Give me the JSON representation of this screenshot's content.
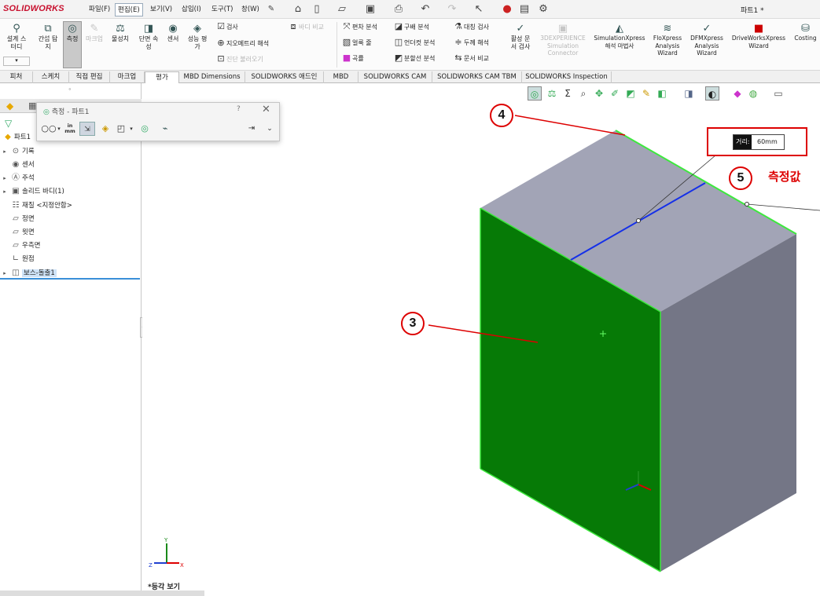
{
  "app": {
    "logo": "SOLIDWORKS",
    "doc_title": "파트1 *"
  },
  "menus": [
    "파일(F)",
    "편집(E)",
    "보기(V)",
    "삽입(I)",
    "도구(T)",
    "창(W)"
  ],
  "ribbon": {
    "big": [
      {
        "label": "설계 스\n터디",
        "icon": "design-study-icon"
      },
      {
        "label": "간섭 탐\n지",
        "icon": "interference-icon"
      },
      {
        "label": "측정",
        "icon": "measure-icon",
        "selected": true
      },
      {
        "label": "마크업",
        "icon": "markup-icon",
        "disabled": true
      },
      {
        "label": "물성치",
        "icon": "mass-properties-icon"
      },
      {
        "label": "단면 속\n성",
        "icon": "section-properties-icon"
      },
      {
        "label": "센서",
        "icon": "sensor-icon"
      },
      {
        "label": "성능 평\n가",
        "icon": "performance-icon"
      }
    ],
    "small_col1": [
      "검사",
      "지오메트리 해석",
      "진단 불러오기"
    ],
    "small_col2": [
      "바디 비교"
    ],
    "small_col3": [
      "편차 분석",
      "얼룩 줄",
      "곡률"
    ],
    "small_col4": [
      "구배 분석",
      "언더컷 분석",
      "분할선 분석"
    ],
    "small_col5": [
      "대칭 검사",
      "두께 해석",
      "문서 비교"
    ],
    "active_check": "활성 문\n서 검사",
    "addins": [
      {
        "label": "3DEXPERIENCE\nSimulation\nConnector",
        "disabled": true
      },
      {
        "label": "SimulationXpress\n해석 마법사"
      },
      {
        "label": "FloXpress\nAnalysis\nWizard"
      },
      {
        "label": "DFMXpress\nAnalysis\nWizard"
      },
      {
        "label": "DriveWorksXpress\nWizard"
      },
      {
        "label": "Costing"
      }
    ]
  },
  "tabs": [
    "피처",
    "스케치",
    "직접 편집",
    "마크업",
    "평가",
    "MBD Dimensions",
    "SOLIDWORKS 애드인",
    "MBD",
    "SOLIDWORKS CAM",
    "SOLIDWORKS CAM TBM",
    "SOLIDWORKS Inspection"
  ],
  "active_tab": "평가",
  "tree": {
    "root": "파트1",
    "items": [
      {
        "label": "기록",
        "expandable": true
      },
      {
        "label": "센서",
        "expandable": false
      },
      {
        "label": "주석",
        "expandable": true
      },
      {
        "label": "솔리드 바디(1)",
        "expandable": true
      },
      {
        "label": "재질 <지정안함>",
        "expandable": false
      },
      {
        "label": "정면",
        "expandable": false
      },
      {
        "label": "윗면",
        "expandable": false
      },
      {
        "label": "우측면",
        "expandable": false
      },
      {
        "label": "원점",
        "expandable": false
      },
      {
        "label": "보스-돌출1",
        "expandable": true,
        "selected": true
      }
    ]
  },
  "measure_dialog": {
    "title": "측정 - 파트1",
    "help": "?",
    "close": "✕",
    "units": "in\nmm"
  },
  "distance": {
    "key": "거리:",
    "value": "60mm"
  },
  "callouts": [
    "3",
    "4",
    "5"
  ],
  "measure_label": "측정값",
  "view_label": "*등각 보기",
  "colors": {
    "front_face": "#067a06",
    "top_face": "#a2a4b6",
    "side_face": "#747686",
    "edge_highlight": "#3ee83e",
    "callout": "#dd0000"
  }
}
